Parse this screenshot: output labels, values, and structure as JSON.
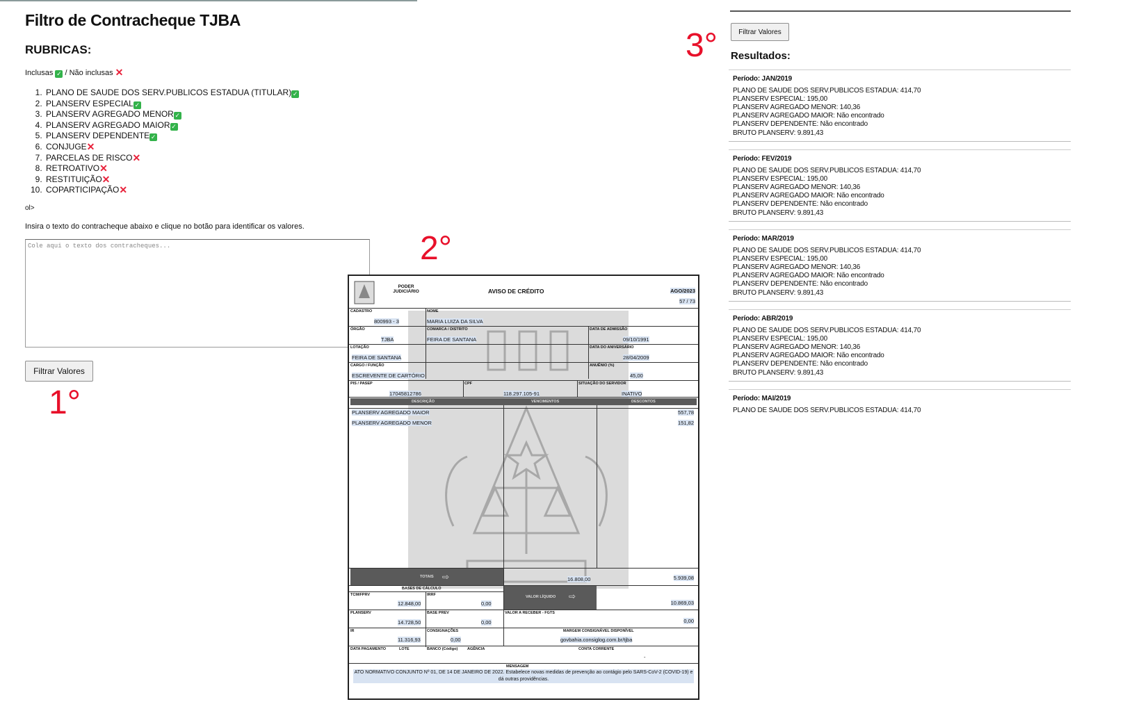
{
  "header": {
    "title": "Filtro de Contracheque TJBA",
    "rubricas_heading": "RUBRICAS:",
    "legend_inclusas": "Inclusas",
    "legend_nao_inclusas": "/ Não inclusas"
  },
  "rubricas": [
    {
      "label": "PLANO DE SAUDE DOS SERV.PUBLICOS ESTADUA (TITULAR)",
      "included": true
    },
    {
      "label": "PLANSERV ESPECIAL",
      "included": true
    },
    {
      "label": "PLANSERV AGREGADO MENOR",
      "included": true
    },
    {
      "label": "PLANSERV AGREGADO MAIOR",
      "included": true
    },
    {
      "label": "PLANSERV DEPENDENTE",
      "included": true
    },
    {
      "label": "CONJUGE",
      "included": false
    },
    {
      "label": "PARCELAS DE RISCO",
      "included": false
    },
    {
      "label": "RETROATIVO",
      "included": false
    },
    {
      "label": "RESTITUIÇÃO",
      "included": false
    },
    {
      "label": "COPARTICIPAÇÃO",
      "included": false
    }
  ],
  "stray_text": "ol>",
  "instructions": "Insira o texto do contracheque abaixo e clique no botão para identificar os valores.",
  "textarea": {
    "placeholder": "Cole aqui o texto dos contracheques...",
    "value": ""
  },
  "filter_button_label": "Filtrar Valores",
  "steps": {
    "one": "1°",
    "two": "2°",
    "three": "3°"
  },
  "results": {
    "heading": "Resultados:",
    "periods": [
      {
        "periodo": "Período: JAN/2019",
        "lines": [
          "PLANO DE SAUDE DOS SERV.PUBLICOS ESTADUA: 414,70",
          "PLANSERV ESPECIAL: 195,00",
          "PLANSERV AGREGADO MENOR: 140,36",
          "PLANSERV AGREGADO MAIOR: Não encontrado",
          "PLANSERV DEPENDENTE: Não encontrado",
          "BRUTO PLANSERV: 9.891,43"
        ]
      },
      {
        "periodo": "Período: FEV/2019",
        "lines": [
          "PLANO DE SAUDE DOS SERV.PUBLICOS ESTADUA: 414,70",
          "PLANSERV ESPECIAL: 195,00",
          "PLANSERV AGREGADO MENOR: 140,36",
          "PLANSERV AGREGADO MAIOR: Não encontrado",
          "PLANSERV DEPENDENTE: Não encontrado",
          "BRUTO PLANSERV: 9.891,43"
        ]
      },
      {
        "periodo": "Período: MAR/2019",
        "lines": [
          "PLANO DE SAUDE DOS SERV.PUBLICOS ESTADUA: 414,70",
          "PLANSERV ESPECIAL: 195,00",
          "PLANSERV AGREGADO MENOR: 140,36",
          "PLANSERV AGREGADO MAIOR: Não encontrado",
          "PLANSERV DEPENDENTE: Não encontrado",
          "BRUTO PLANSERV: 9.891,43"
        ]
      },
      {
        "periodo": "Período: ABR/2019",
        "lines": [
          "PLANO DE SAUDE DOS SERV.PUBLICOS ESTADUA: 414,70",
          "PLANSERV ESPECIAL: 195,00",
          "PLANSERV AGREGADO MENOR: 140,36",
          "PLANSERV AGREGADO MAIOR: Não encontrado",
          "PLANSERV DEPENDENTE: Não encontrado",
          "BRUTO PLANSERV: 9.891,43"
        ]
      },
      {
        "periodo": "Período: MAI/2019",
        "lines": [
          "PLANO DE SAUDE DOS SERV.PUBLICOS ESTADUA: 414,70"
        ]
      }
    ]
  },
  "payslip": {
    "org": "PODER JUDICIÁRIO",
    "title": "AVISO DE CRÉDITO",
    "ref": "AGO/2023",
    "page": "57 / 73",
    "lbl_cadastro": "CADASTRO",
    "cadastro": "800993 - 3",
    "lbl_nome": "NOME",
    "nome": "MARIA LUIZA DA SILVA",
    "lbl_orgao": "ÓRGÃO",
    "orgao": "TJBA",
    "lbl_comarca": "COMARCA / DISTRITO",
    "comarca": "FEIRA DE SANTANA",
    "lbl_admissao": "DATA DE ADMISSÃO",
    "admissao": "09/10/1991",
    "lbl_lotacao": "LOTAÇÃO",
    "lotacao": "FEIRA DE SANTANA",
    "lbl_data2": "DATA DO ANIVERSÁRIO",
    "data2": "28/04/2009",
    "lbl_cargo": "CARGO / FUNÇÃO",
    "cargo": "ESCREVENTE DE CARTÓRIO",
    "lbl_anuenio": "ANUÊNIO (%)",
    "anuenio": "45,00",
    "lbl_pis": "PIS / PASEP",
    "pis": "17045812786",
    "lbl_cpf": "CPF",
    "cpf": "118.297.105-91",
    "lbl_situacao": "SITUAÇÃO DO SERVIDOR",
    "situacao": "INATIVO",
    "col_descricao": "DESCRIÇÃO",
    "col_vencimentos": "VENCIMENTOS",
    "col_descontos": "DESCONTOS",
    "items": [
      {
        "desc": "PLANSERV AGREGADO MAIOR",
        "desconto": "557,78"
      },
      {
        "desc": "PLANSERV AGREGADO MENOR",
        "desconto": "151,82"
      }
    ],
    "totais_label": "TOTAIS",
    "total_vencimentos": "16.808,00",
    "total_descontos": "5.939,08",
    "bases_label": "BASES DE CÁLCULO",
    "valor_liquido_label": "VALOR LÍQUIDO",
    "valor_liquido": "10.869,03",
    "lbl_tcm": "TCM/FPRV",
    "tcm": "12.848,00",
    "lbl_irrf": "IRRF",
    "irrf": "0,00",
    "lbl_planserv": "PLANSERV",
    "planserv": "14.728,50",
    "lbl_baseprev": "BASE PREV",
    "baseprev": "0,00",
    "lbl_valor_receber": "VALOR A RECEBER - FGTS",
    "valor_receber": "0,00",
    "lbl_ir": "IR",
    "ir": "11.316,93",
    "lbl_consignacoes": "CONSIGNAÇÕES",
    "consignacoes": "0,00",
    "lbl_margem": "MARGEM CONSIGNÁVEL DISPONÍVEL",
    "margem_site": "govbahia.consiglog.com.br/tjba",
    "lbl_data_pag": "DATA PAGAMENTO",
    "lbl_lote": "LOTE",
    "lbl_banco": "BANCO (Código)",
    "lbl_agencia": "AGÊNCIA",
    "lbl_conta": "CONTA CORRENTE",
    "conta_val": "-",
    "msg_label": "MENSAGEM",
    "mensagem": "ATO NORMATIVO CONJUNTO Nº 01, DE 14 DE JANEIRO DE 2022. Estabelece novas medidas de prevenção ao contágio pelo SARS-CoV-2 (COVID-19) e dá outras providências."
  },
  "colors": {
    "check": "#33b24a",
    "cross": "#e8213a",
    "step": "#e8102a"
  }
}
